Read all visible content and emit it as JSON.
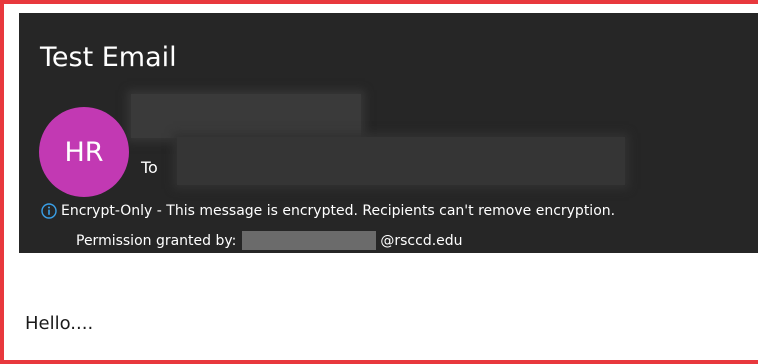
{
  "email": {
    "subject": "Test Email",
    "avatar_initials": "HR",
    "avatar_color": "#c239b3",
    "to_label": "To",
    "protection_icon": "info-icon",
    "protection_notice": "Encrypt-Only - This message is encrypted. Recipients can't remove encryption.",
    "permission_label": "Permission granted by:",
    "permission_domain": "@rsccd.edu",
    "body": "Hello...."
  },
  "colors": {
    "frame_border": "#e8383d",
    "header_background": "#262626",
    "accent_blue": "#3aa0e8"
  }
}
